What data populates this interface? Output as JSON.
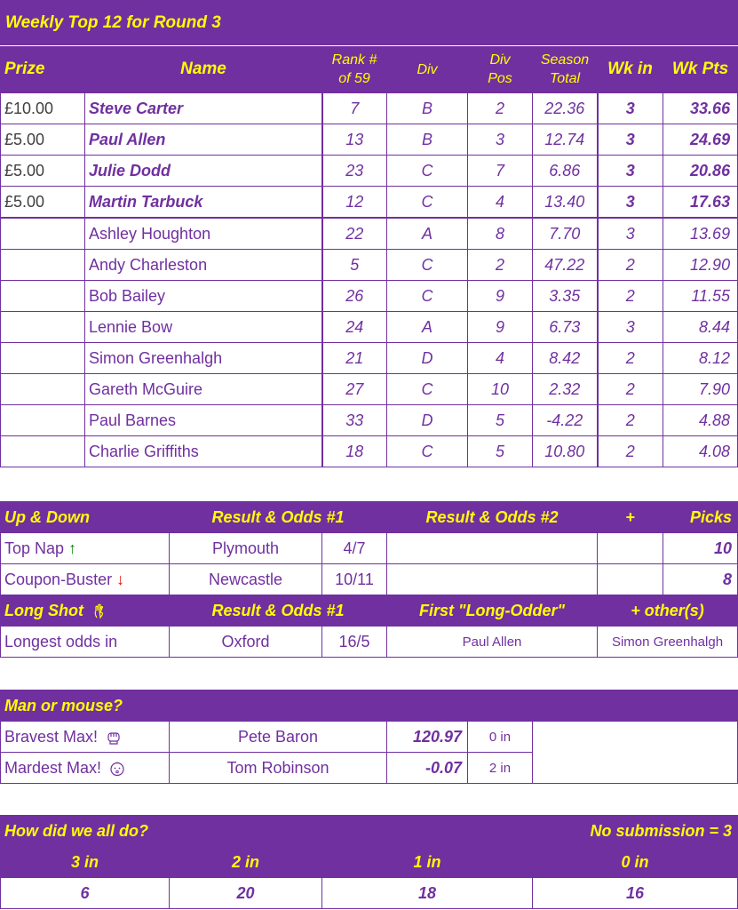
{
  "weekly": {
    "title": "Weekly Top 12 for Round 3",
    "headers": {
      "prize": "Prize",
      "name": "Name",
      "rank_line1": "Rank #",
      "rank_line2": "of 59",
      "div": "Div",
      "divpos_line1": "Div",
      "divpos_line2": "Pos",
      "season_line1": "Season",
      "season_line2": "Total",
      "wkin": "Wk in",
      "wkpts": "Wk Pts"
    },
    "rows": [
      {
        "prize": "£10.00",
        "name": "Steve Carter",
        "rank": "7",
        "div": "B",
        "divpos": "2",
        "season": "22.36",
        "wkin": "3",
        "wkpts": "33.66"
      },
      {
        "prize": "£5.00",
        "name": "Paul Allen",
        "rank": "13",
        "div": "B",
        "divpos": "3",
        "season": "12.74",
        "wkin": "3",
        "wkpts": "24.69"
      },
      {
        "prize": "£5.00",
        "name": "Julie Dodd",
        "rank": "23",
        "div": "C",
        "divpos": "7",
        "season": "6.86",
        "wkin": "3",
        "wkpts": "20.86"
      },
      {
        "prize": "£5.00",
        "name": "Martin Tarbuck",
        "rank": "12",
        "div": "C",
        "divpos": "4",
        "season": "13.40",
        "wkin": "3",
        "wkpts": "17.63"
      },
      {
        "prize": "",
        "name": "Ashley Houghton",
        "rank": "22",
        "div": "A",
        "divpos": "8",
        "season": "7.70",
        "wkin": "3",
        "wkpts": "13.69"
      },
      {
        "prize": "",
        "name": "Andy Charleston",
        "rank": "5",
        "div": "C",
        "divpos": "2",
        "season": "47.22",
        "wkin": "2",
        "wkpts": "12.90"
      },
      {
        "prize": "",
        "name": "Bob Bailey",
        "rank": "26",
        "div": "C",
        "divpos": "9",
        "season": "3.35",
        "wkin": "2",
        "wkpts": "11.55"
      },
      {
        "prize": "",
        "name": "Lennie Bow",
        "rank": "24",
        "div": "A",
        "divpos": "9",
        "season": "6.73",
        "wkin": "3",
        "wkpts": "8.44"
      },
      {
        "prize": "",
        "name": "Simon Greenhalgh",
        "rank": "21",
        "div": "D",
        "divpos": "4",
        "season": "8.42",
        "wkin": "2",
        "wkpts": "8.12"
      },
      {
        "prize": "",
        "name": "Gareth McGuire",
        "rank": "27",
        "div": "C",
        "divpos": "10",
        "season": "2.32",
        "wkin": "2",
        "wkpts": "7.90"
      },
      {
        "prize": "",
        "name": "Paul Barnes",
        "rank": "33",
        "div": "D",
        "divpos": "5",
        "season": "-4.22",
        "wkin": "2",
        "wkpts": "4.88"
      },
      {
        "prize": "",
        "name": "Charlie Griffiths",
        "rank": "18",
        "div": "C",
        "divpos": "5",
        "season": "10.80",
        "wkin": "2",
        "wkpts": "4.08"
      }
    ]
  },
  "updown": {
    "header": {
      "col1": "Up & Down",
      "col2": "Result & Odds #1",
      "col3": "Result & Odds #2",
      "col4": "+",
      "col5": "Picks"
    },
    "topnap": {
      "label": "Top Nap",
      "arrow": "↑",
      "team": "Plymouth",
      "odds": "4/7",
      "picks": "10"
    },
    "buster": {
      "label": "Coupon-Buster",
      "arrow": "↓",
      "team": "Newcastle",
      "odds": "10/11",
      "picks": "8"
    },
    "longshot_header": {
      "col1": "Long Shot",
      "col2": "Result & Odds #1",
      "col3": "First \"Long-Odder\"",
      "col4": "+ other(s)"
    },
    "longest": {
      "label": "Longest odds in",
      "team": "Oxford",
      "odds": "16/5",
      "first": "Paul Allen",
      "others": "Simon Greenhalgh"
    },
    "icons": {
      "longshot": "crossed-fingers-icon"
    }
  },
  "mouse": {
    "header": "Man or mouse?",
    "bravest": {
      "label": "Bravest Max!",
      "name": "Pete Baron",
      "pts": "120.97",
      "in": "0 in"
    },
    "mardest": {
      "label": "Mardest Max!",
      "name": "Tom Robinson",
      "pts": "-0.07",
      "in": "2 in"
    },
    "icons": {
      "bravest": "fist-icon",
      "mardest": "baby-face-icon"
    }
  },
  "summary": {
    "title": "How did we all do?",
    "nosub": "No submission = 3",
    "headers": [
      "3 in",
      "2 in",
      "1 in",
      "0 in"
    ],
    "values": [
      "6",
      "20",
      "18",
      "16"
    ]
  },
  "colors": {
    "purple": "#7030a0",
    "yellow": "#ffff00",
    "green_arrow": "#0a8a0a",
    "red_arrow": "#e01010"
  }
}
